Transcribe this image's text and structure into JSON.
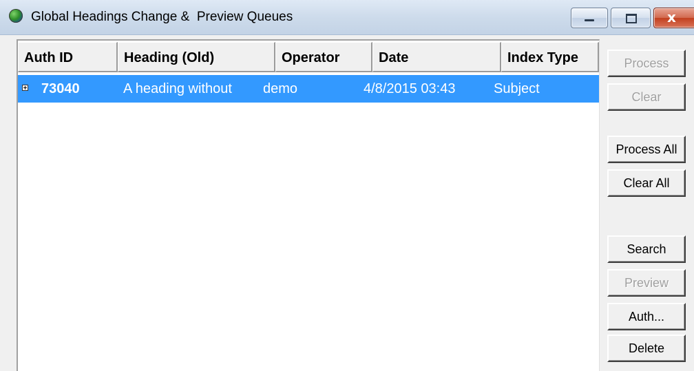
{
  "window": {
    "title": "Global Headings Change &  Preview Queues",
    "icon": "globe-icon",
    "controls": {
      "minimize": "minimize-icon",
      "maximize": "maximize-icon",
      "close": "close-icon",
      "close_glyph": "x"
    }
  },
  "table": {
    "columns": [
      "Auth ID",
      "Heading (Old)",
      "Operator",
      "Date",
      "Index Type"
    ],
    "rows": [
      {
        "expand_icon": "plus-box-icon",
        "auth_id": "73040",
        "heading_old": "A heading without",
        "operator": "demo",
        "date": "4/8/2015 03:43",
        "index_type": "Subject",
        "selected": true
      }
    ],
    "selection_color": "#3399ff"
  },
  "buttons": {
    "process": {
      "label": "Process",
      "enabled": false
    },
    "clear": {
      "label": "Clear",
      "enabled": false
    },
    "process_all": {
      "label": "Process All",
      "enabled": true
    },
    "clear_all": {
      "label": "Clear All",
      "enabled": true
    },
    "search": {
      "label": "Search",
      "enabled": true
    },
    "preview": {
      "label": "Preview",
      "enabled": false
    },
    "auth": {
      "label": "Auth...",
      "enabled": true
    },
    "delete": {
      "label": "Delete",
      "enabled": true
    }
  }
}
